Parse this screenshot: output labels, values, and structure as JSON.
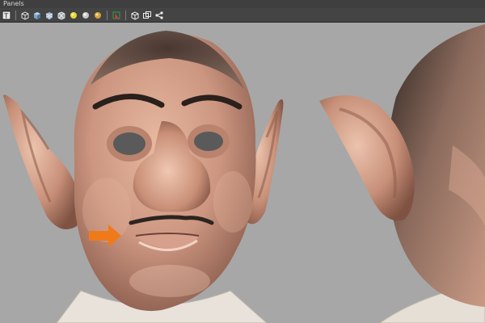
{
  "menubar": {
    "panels_label": "Panels"
  },
  "toolbar": {
    "icons": [
      "text-toggle-icon",
      "wireframe-cube-icon",
      "smooth-shade-cube-icon",
      "textured-cube-icon",
      "xray-icon",
      "use-default-lights-icon",
      "all-lights-icon",
      "shadows-icon",
      "isolate-select-icon",
      "camera-icon",
      "multi-view-icon",
      "node-graph-icon"
    ]
  },
  "viewport": {
    "background": "#a7a7a7",
    "annotation": {
      "type": "arrow",
      "color": "#f07a1a",
      "points_to": "mouth-corner"
    },
    "models": [
      "character-head-front",
      "character-head-side"
    ]
  }
}
